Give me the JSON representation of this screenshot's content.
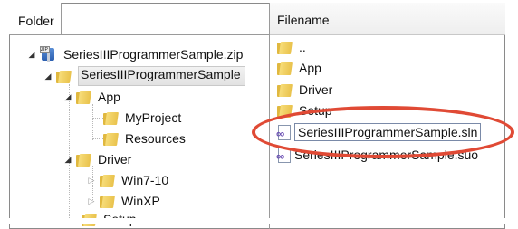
{
  "left_pane": {
    "tab_label": "Folder",
    "tree": {
      "root": "SeriesIIIProgrammerSample.zip",
      "project": "SeriesIIIProgrammerSample",
      "app": "App",
      "myproject": "MyProject",
      "resources": "Resources",
      "driver": "Driver",
      "win7": "Win7-10",
      "winxp": "WinXP",
      "setup": "Setup"
    }
  },
  "right_pane": {
    "header": "Filename",
    "files": [
      {
        "name": "..",
        "icon": "folder-icon"
      },
      {
        "name": "App",
        "icon": "folder-icon"
      },
      {
        "name": "Driver",
        "icon": "folder-icon"
      },
      {
        "name": "Setup",
        "icon": "folder-icon"
      },
      {
        "name": "SeriesIIIProgrammerSample.sln",
        "icon": "solution-file-icon"
      },
      {
        "name": "SeriesIIIProgrammerSample.suo",
        "icon": "solution-file-icon"
      }
    ]
  },
  "colors": {
    "highlight_ring": "#e04a35",
    "folder": "#e9c24c",
    "solution_icon": "#6b4fb3"
  }
}
